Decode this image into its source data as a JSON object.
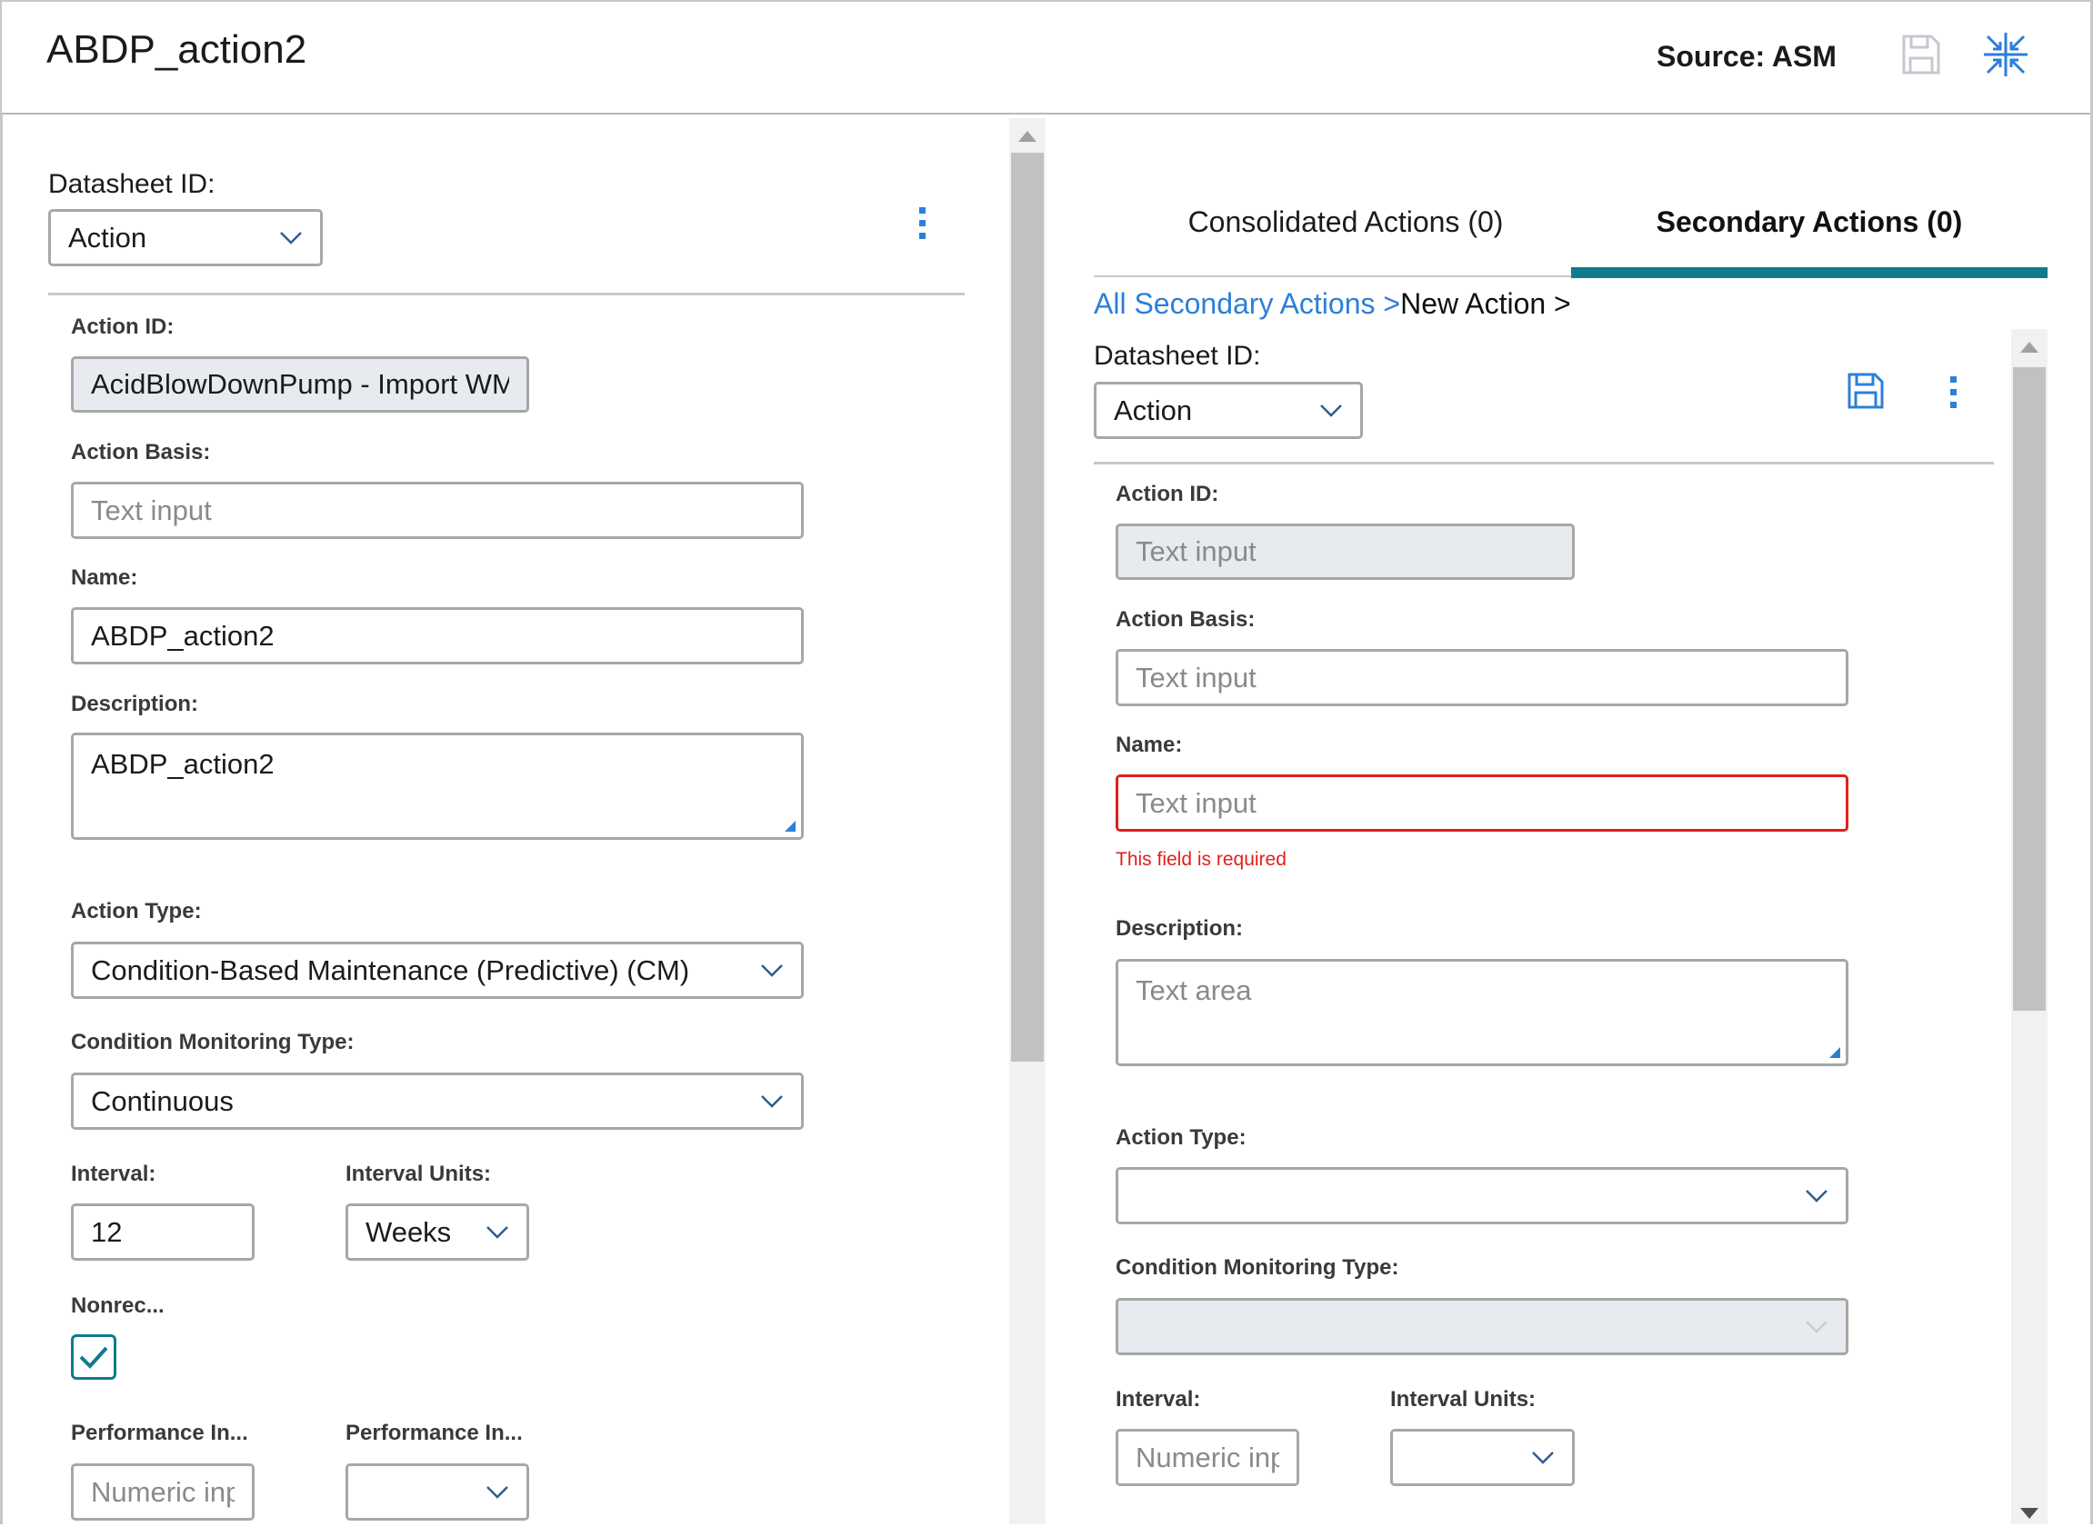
{
  "header": {
    "title": "ABDP_action2",
    "source": "Source: ASM",
    "save_icon": "floppy-disk-icon",
    "collapse_icon": "collapse-arrows-icon"
  },
  "left": {
    "datasheet_label": "Datasheet ID:",
    "datasheet_value": "Action",
    "action_id_label": "Action ID:",
    "action_id_value": "AcidBlowDownPump - Import WM",
    "action_basis_label": "Action Basis:",
    "action_basis_placeholder": "Text input",
    "name_label": "Name:",
    "name_value": "ABDP_action2",
    "description_label": "Description:",
    "description_value": "ABDP_action2",
    "action_type_label": "Action Type:",
    "action_type_value": "Condition-Based Maintenance (Predictive) (CM)",
    "cm_type_label": "Condition Monitoring Type:",
    "cm_type_value": "Continuous",
    "interval_label": "Interval:",
    "interval_value": "12",
    "interval_units_label": "Interval Units:",
    "interval_units_value": "Weeks",
    "nonrec_label": "Nonrec...",
    "nonrec_checked": true,
    "perf1_label": "Performance In...",
    "perf1_placeholder": "Numeric inp",
    "perf2_label": "Performance In...",
    "perf2_value": ""
  },
  "right": {
    "tabs": [
      {
        "label": "Consolidated Actions (0)",
        "active": false
      },
      {
        "label": "Secondary Actions (0)",
        "active": true
      }
    ],
    "breadcrumb_link": "All Secondary Actions >",
    "breadcrumb_current": "New Action >",
    "datasheet_label": "Datasheet ID:",
    "datasheet_value": "Action",
    "action_id_label": "Action ID:",
    "action_id_placeholder": "Text input",
    "action_basis_label": "Action Basis:",
    "action_basis_placeholder": "Text input",
    "name_label": "Name:",
    "name_placeholder": "Text input",
    "name_error": "This field is required",
    "description_label": "Description:",
    "description_placeholder": "Text area",
    "action_type_label": "Action Type:",
    "action_type_value": "",
    "cm_type_label": "Condition Monitoring Type:",
    "cm_type_value": "",
    "interval_label": "Interval:",
    "interval_placeholder": "Numeric inp",
    "interval_units_label": "Interval Units:",
    "interval_units_value": ""
  },
  "colors": {
    "accent": "#2c7fd8",
    "tab_underline": "#107b8c",
    "error": "#e0201a",
    "checkbox": "#107b8c"
  }
}
